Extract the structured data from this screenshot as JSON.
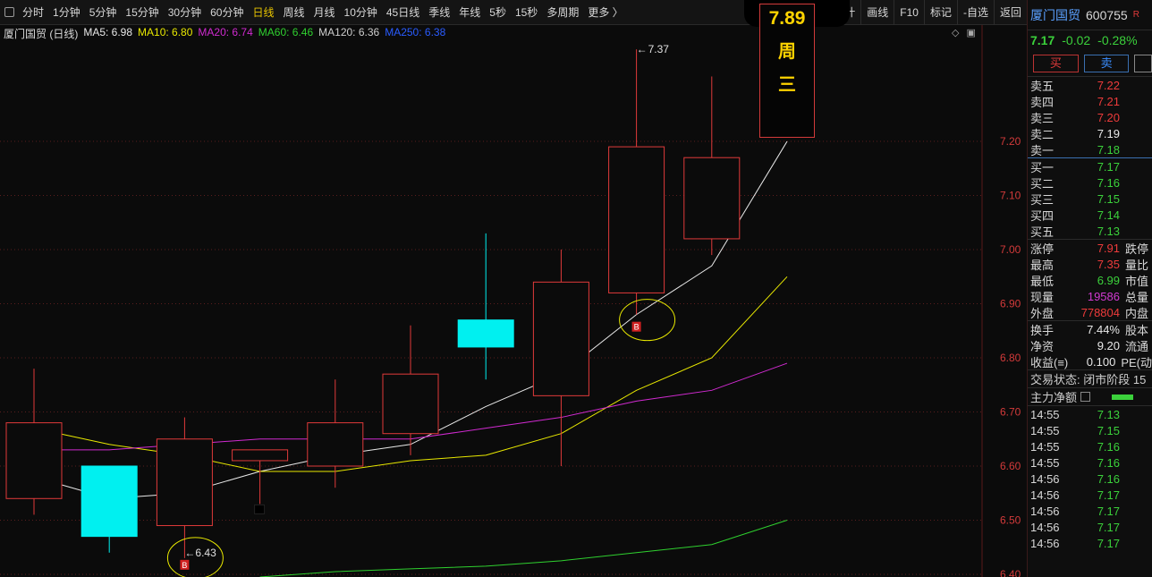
{
  "toolbar": {
    "periods": [
      "分时",
      "1分钟",
      "5分钟",
      "15分钟",
      "30分钟",
      "60分钟",
      "日线",
      "周线",
      "月线",
      "10分钟",
      "45日线",
      "季线",
      "年线",
      "5秒",
      "15秒",
      "多周期",
      "更多 〉"
    ],
    "active_period": "日线",
    "tools": [
      "统计",
      "画线",
      "F10",
      "标记",
      "-自选",
      "返回"
    ]
  },
  "legend": {
    "title": "厦门国贸 (日线)",
    "ma5": "MA5: 6.98",
    "ma10": "MA10: 6.80",
    "ma20": "MA20: 6.74",
    "ma60": "MA60: 6.46",
    "ma120": "MA120: 6.36",
    "ma250": "MA250: 6.38"
  },
  "colors": {
    "up": "#e03a3a",
    "down": "#00f0f0",
    "ma5": "#e8e8e8",
    "ma10": "#e8e800",
    "ma20": "#d02ad0",
    "ma60": "#2fd02f",
    "ma120": "#cfcfcf",
    "ma250": "#2a5cff",
    "signal": "#e8e800"
  },
  "price_tag": {
    "price": "7.89",
    "line1": "周",
    "line2": "三"
  },
  "annotations": {
    "high_label": "7.37",
    "low_label": "6.43",
    "buy_marker": "B"
  },
  "chart_data": {
    "type": "candlestick",
    "y_ticks": [
      "7.20",
      "7.10",
      "7.00",
      "6.90",
      "6.80",
      "6.70",
      "6.60",
      "6.50",
      "6.40"
    ],
    "ylim": [
      6.395,
      7.415
    ],
    "candles": [
      {
        "o": 6.54,
        "h": 6.78,
        "l": 6.51,
        "c": 6.68
      },
      {
        "o": 6.6,
        "h": 6.6,
        "l": 6.44,
        "c": 6.47
      },
      {
        "o": 6.49,
        "h": 6.69,
        "l": 6.43,
        "c": 6.65
      },
      {
        "o": 6.61,
        "h": 6.63,
        "l": 6.53,
        "c": 6.63
      },
      {
        "o": 6.6,
        "h": 6.76,
        "l": 6.56,
        "c": 6.68
      },
      {
        "o": 6.66,
        "h": 6.86,
        "l": 6.62,
        "c": 6.77
      },
      {
        "o": 6.87,
        "h": 7.03,
        "l": 6.76,
        "c": 6.82
      },
      {
        "o": 6.73,
        "h": 7.0,
        "l": 6.6,
        "c": 6.94
      },
      {
        "o": 6.92,
        "h": 7.37,
        "l": 6.88,
        "c": 7.19
      },
      {
        "o": 7.02,
        "h": 7.32,
        "l": 6.99,
        "c": 7.17
      }
    ],
    "series": [
      {
        "name": "MA5",
        "values": [
          6.58,
          6.54,
          6.55,
          6.59,
          6.62,
          6.64,
          6.71,
          6.77,
          6.88,
          6.97,
          7.2
        ]
      },
      {
        "name": "MA10",
        "values": [
          6.67,
          6.64,
          6.62,
          6.59,
          6.59,
          6.61,
          6.62,
          6.66,
          6.74,
          6.8,
          6.95
        ]
      },
      {
        "name": "MA20",
        "values": [
          6.63,
          6.63,
          6.64,
          6.65,
          6.65,
          6.65,
          6.67,
          6.69,
          6.72,
          6.74,
          6.79
        ]
      },
      {
        "name": "MA60",
        "values": [
          null,
          null,
          null,
          6.395,
          6.405,
          6.41,
          6.415,
          6.425,
          6.44,
          6.455,
          6.5
        ]
      }
    ],
    "signals": [
      {
        "index": 2,
        "price": 6.43,
        "label": "6.43"
      },
      {
        "index": 8,
        "price": 6.87
      }
    ],
    "high_point": {
      "index": 8,
      "price": 7.37,
      "label": "7.37"
    },
    "small_marker": {
      "index": 3,
      "price": 6.52
    }
  },
  "panel": {
    "stock_name": "厦门国贸",
    "stock_code": "600755",
    "stock_flag": "R",
    "price": "7.17",
    "change": "-0.02",
    "pct": "-0.28%",
    "buy_label": "买",
    "sell_label": "卖",
    "asks": [
      {
        "label": "卖五",
        "price": "7.22",
        "cls": "red"
      },
      {
        "label": "卖四",
        "price": "7.21",
        "cls": "red"
      },
      {
        "label": "卖三",
        "price": "7.20",
        "cls": "red"
      },
      {
        "label": "卖二",
        "price": "7.19",
        "cls": "white"
      },
      {
        "label": "卖一",
        "price": "7.18",
        "cls": "green"
      }
    ],
    "bids": [
      {
        "label": "买一",
        "price": "7.17",
        "cls": "green"
      },
      {
        "label": "买二",
        "price": "7.16",
        "cls": "green"
      },
      {
        "label": "买三",
        "price": "7.15",
        "cls": "green"
      },
      {
        "label": "买四",
        "price": "7.14",
        "cls": "green"
      },
      {
        "label": "买五",
        "price": "7.13",
        "cls": "green"
      }
    ],
    "stats1": [
      {
        "label": "涨停",
        "value": "7.91",
        "cls": "red",
        "extra": "跌停"
      },
      {
        "label": "最高",
        "value": "7.35",
        "cls": "red",
        "extra": "量比"
      },
      {
        "label": "最低",
        "value": "6.99",
        "cls": "green",
        "extra": "市值"
      },
      {
        "label": "现量",
        "value": "19586",
        "cls": "magenta",
        "extra": "总量"
      },
      {
        "label": "外盘",
        "value": "778804",
        "cls": "red",
        "extra": "内盘"
      }
    ],
    "stats2": [
      {
        "label": "换手",
        "value": "7.44%",
        "cls": "white",
        "extra": "股本"
      },
      {
        "label": "净资",
        "value": "9.20",
        "cls": "white",
        "extra": "流通"
      },
      {
        "label": "收益(≡)",
        "value": "0.100",
        "cls": "white",
        "extra": "PE(动"
      }
    ],
    "status": "交易状态: 闭市阶段 15",
    "flow_title": "主力净额",
    "ticks": [
      {
        "time": "14:55",
        "price": "7.13"
      },
      {
        "time": "14:55",
        "price": "7.15"
      },
      {
        "time": "14:55",
        "price": "7.16"
      },
      {
        "time": "14:55",
        "price": "7.16"
      },
      {
        "time": "14:56",
        "price": "7.16"
      },
      {
        "time": "14:56",
        "price": "7.17"
      },
      {
        "time": "14:56",
        "price": "7.17"
      },
      {
        "time": "14:56",
        "price": "7.17"
      },
      {
        "time": "14:56",
        "price": "7.17"
      }
    ]
  }
}
